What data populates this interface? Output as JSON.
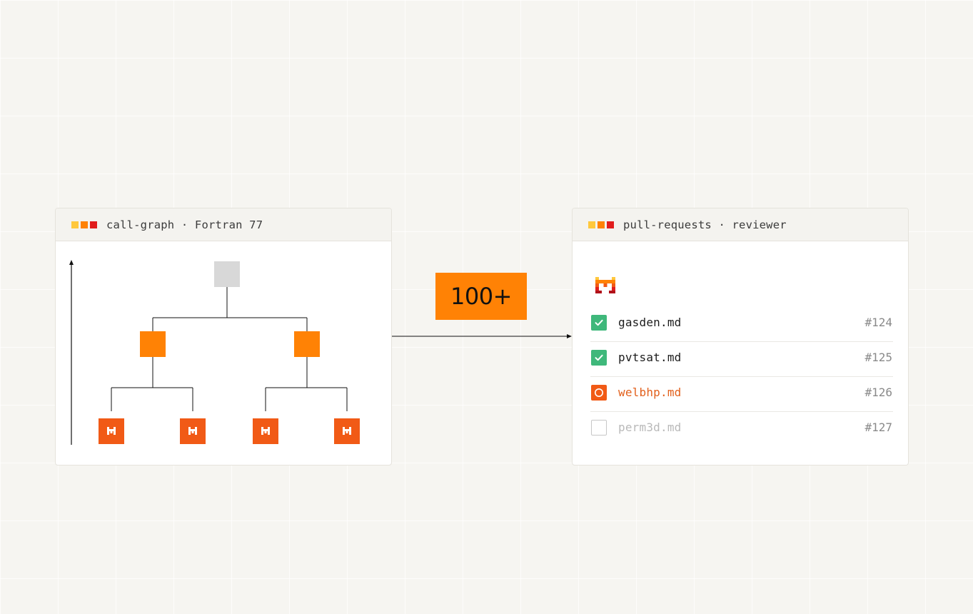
{
  "left_panel": {
    "title": "call-graph · Fortran 77",
    "dot_colors": [
      "#ffc83d",
      "#ff8205",
      "#e11d1d"
    ],
    "tree": {
      "root_color": "#d8d8d8",
      "mid_color": "#ff8205",
      "leaf_color": "#f15a16",
      "leaf_icon": "mascot-icon"
    }
  },
  "connector": {
    "badge_text": "100+",
    "badge_color": "#ff8205"
  },
  "right_panel": {
    "title": "pull-requests · reviewer",
    "dot_colors": [
      "#ffc83d",
      "#ff8205",
      "#e11d1d"
    ],
    "logo_icon": "mascot-icon",
    "items": [
      {
        "file": "gasden.md",
        "number": "#124",
        "status": "done"
      },
      {
        "file": "pvtsat.md",
        "number": "#125",
        "status": "done"
      },
      {
        "file": "welbhp.md",
        "number": "#126",
        "status": "active"
      },
      {
        "file": "perm3d.md",
        "number": "#127",
        "status": "todo"
      }
    ],
    "status_colors": {
      "done": "#3fb87b",
      "active": "#f15a16",
      "todo": "#c7c7c7"
    }
  }
}
